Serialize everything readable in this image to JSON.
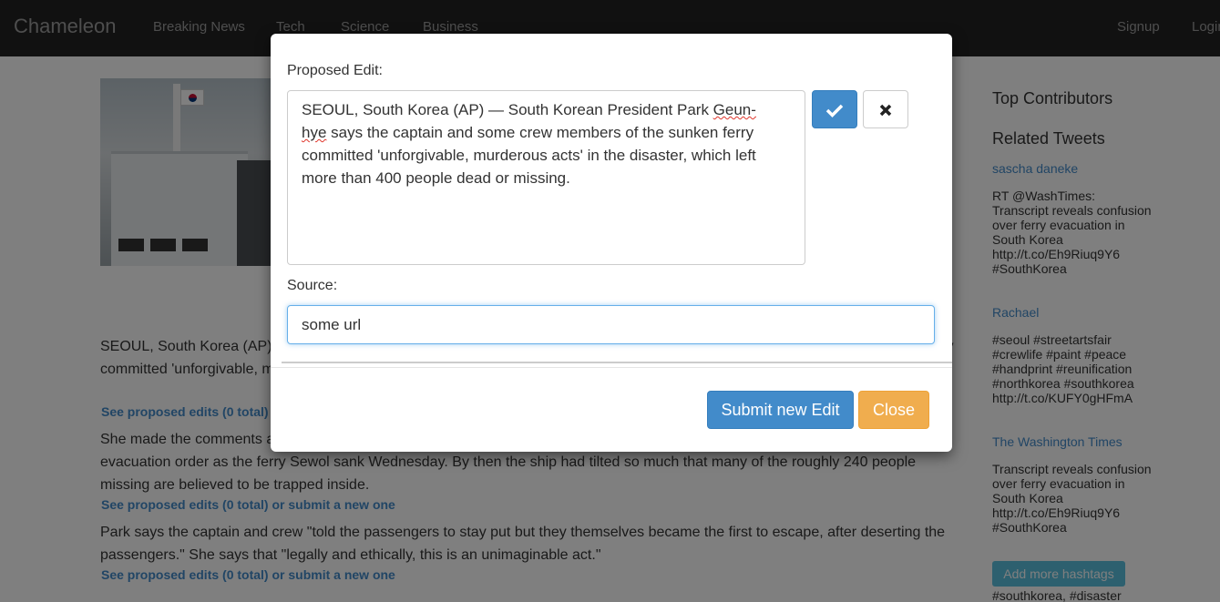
{
  "navbar": {
    "brand": "Chameleon",
    "links": [
      "Breaking News",
      "Tech",
      "Science",
      "Business"
    ],
    "signup": "Signup",
    "login": "Login"
  },
  "article": {
    "paragraphs": [
      "SEOUL, South Korea (AP) — South Korean President Park Geun-hye says the captain and some crew members of the sunken ferry committed 'unforgivable, murderous acts' in the disaster, which left more than 400 people dead or missing.",
      "She made the comments as the captain and some crew members were reported to have waited more than half an hour to issue an evacuation order as the ferry Sewol sank Wednesday. By then the ship had tilted so much that many of the roughly 240 people missing are believed to be trapped inside.",
      "Park says the captain and crew \"told the passengers to stay put but they themselves became the first to escape, after deserting the passengers.\" She says that \"legally and ethically, this is an unimaginable act.\""
    ],
    "edits_link": "See proposed edits (0 total) or submit a new one"
  },
  "sidebar": {
    "top_contributors": "Top Contributors",
    "related_tweets": "Related Tweets",
    "tweets": [
      {
        "user": "sascha daneke",
        "text": "RT @WashTimes: Transcript reveals confusion over ferry evacuation in South Korea http://t.co/Eh9Riuq9Y6 #SouthKorea"
      },
      {
        "user": "Rachael",
        "text": "#seoul #streetartsfair #crewlife #paint #peace #handprint #reunification #northkorea #southkorea http://t.co/KUFY0gHFmA"
      },
      {
        "user": "The Washington Times",
        "text": "Transcript reveals confusion over ferry evacuation in South Korea http://t.co/Eh9Riuq9Y6 #SouthKorea"
      }
    ],
    "add_hashtags": "Add more hashtags",
    "hashtags": "#southkorea, #disaster"
  },
  "modal": {
    "proposed_label": "Proposed Edit:",
    "proposed_text_before": "SEOUL, South Korea (AP) — South Korean President Park ",
    "proposed_text_misspelled_a": "Geun-",
    "proposed_text_misspelled_b": "hye",
    "proposed_text_after": " says the captain and some crew members of the sunken ferry committed 'unforgivable, murderous acts' in the disaster, which left more than 400 people dead or missing.",
    "confirm_icon": "checkmark-icon",
    "cancel_icon": "close-icon",
    "source_label": "Source:",
    "source_value": "some url",
    "submit_label": "Submit new Edit",
    "close_label": "Close"
  }
}
